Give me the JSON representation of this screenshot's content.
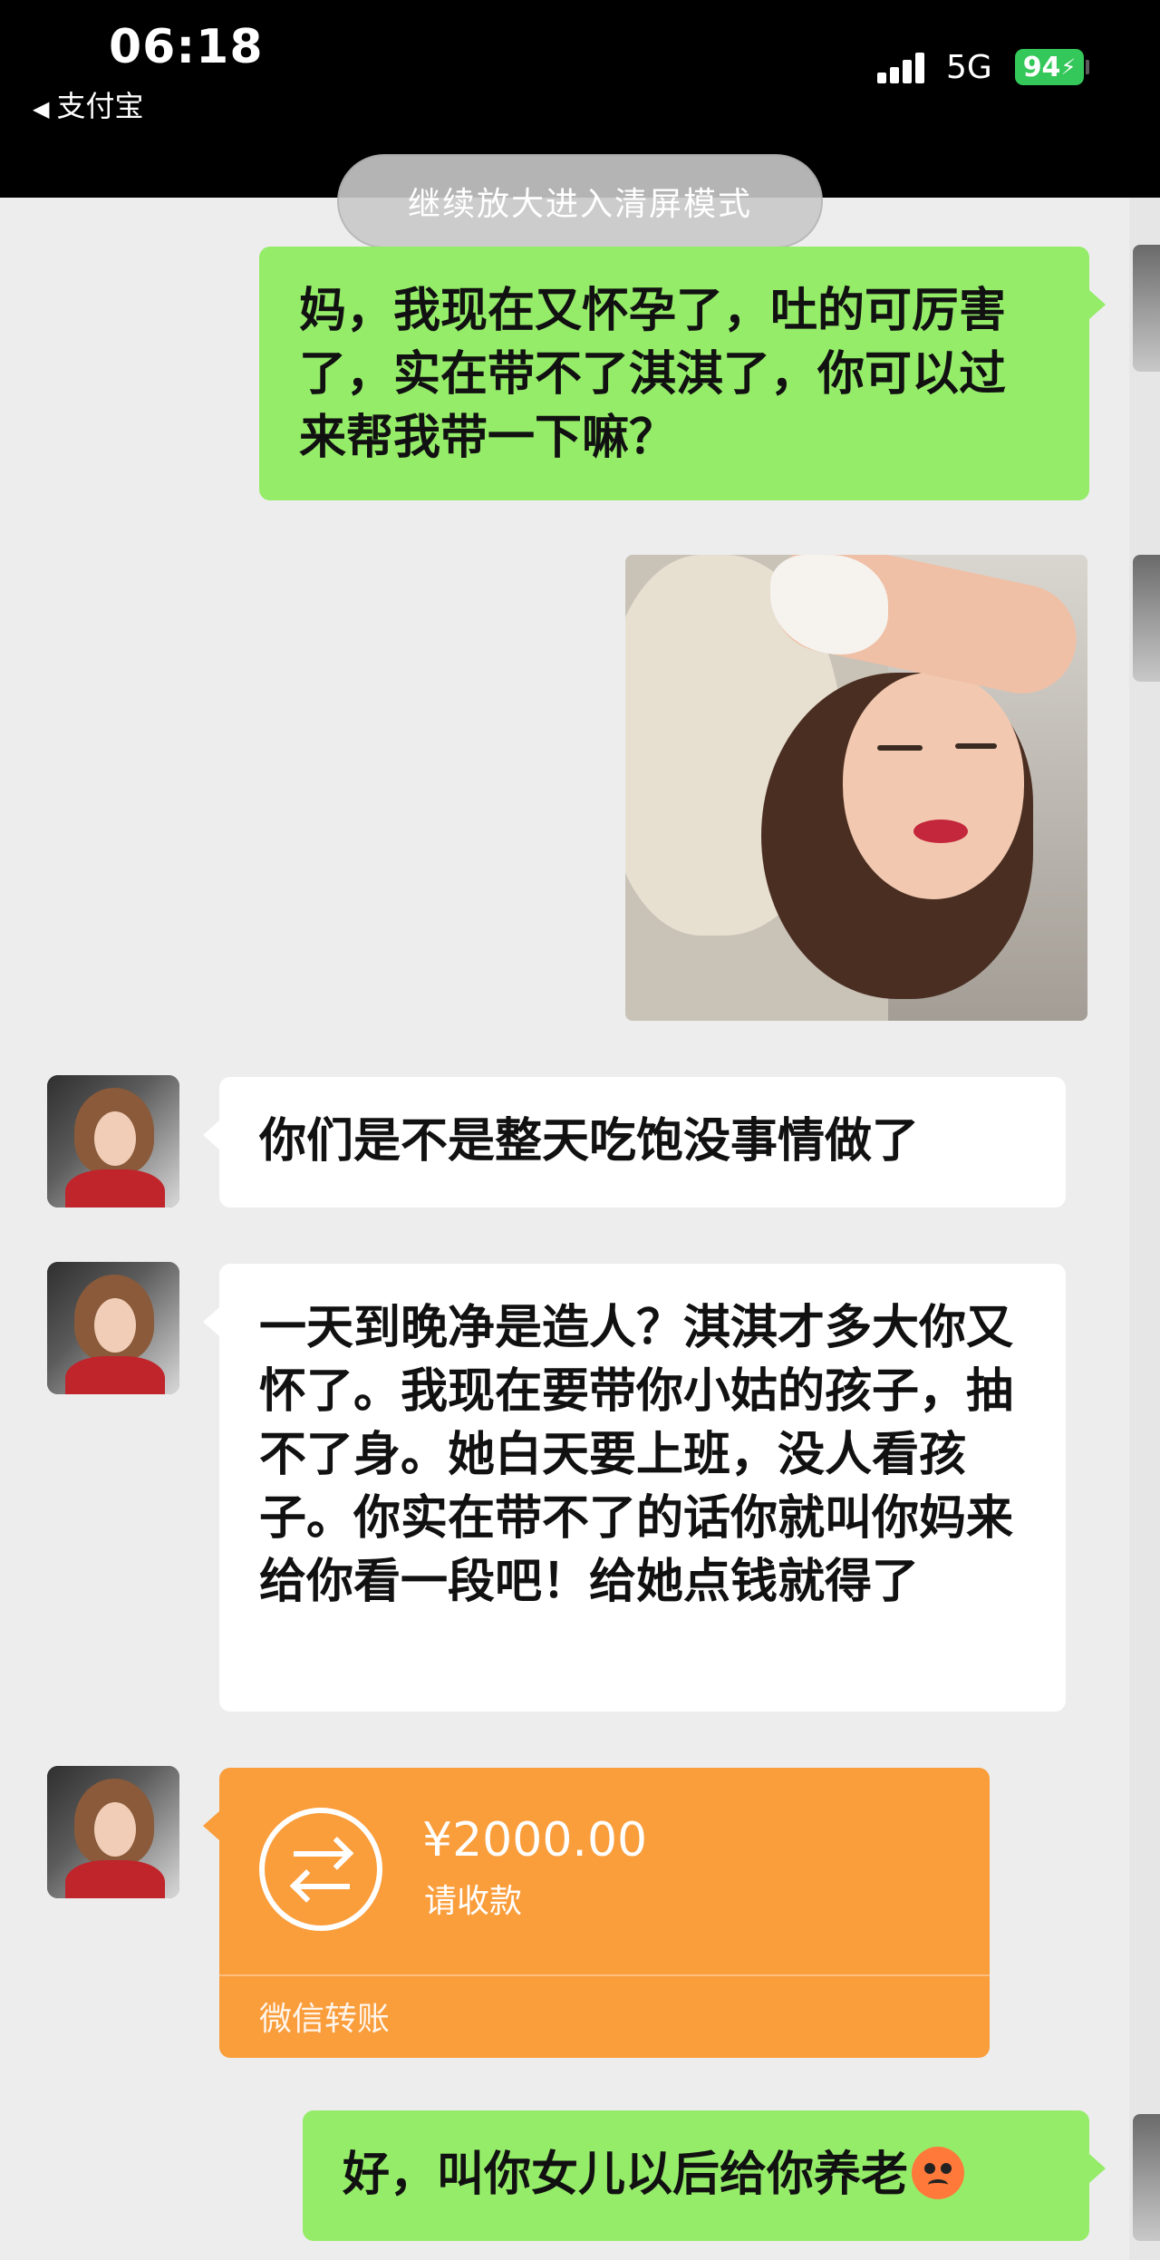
{
  "status_bar": {
    "time": "06:18",
    "back_app": "支付宝",
    "network": "5G",
    "battery": "94"
  },
  "toast": {
    "text": "继续放大进入清屏模式"
  },
  "messages": [
    {
      "from": "me",
      "type": "text",
      "text": "妈，我现在又怀孕了，吐的可厉害了，实在带不了淇淇了，你可以过来帮我带一下嘛？"
    },
    {
      "from": "me",
      "type": "image",
      "image_desc": "woman lying sick in bed"
    },
    {
      "from": "mom",
      "type": "text",
      "text": "你们是不是整天吃饱没事情做了"
    },
    {
      "from": "mom",
      "type": "text",
      "text": "一天到晚净是造人？淇淇才多大你又怀了。我现在要带你小姑的孩子，抽不了身。她白天要上班，没人看孩子。你实在带不了的话你就叫你妈来给你看一段吧！给她点钱就得了"
    },
    {
      "from": "mom",
      "type": "transfer",
      "amount": "¥2000.00",
      "status": "请收款",
      "brand": "微信转账"
    },
    {
      "from": "me",
      "type": "text",
      "text": "好，叫你女儿以后给你养老",
      "emoji": "angry-face"
    }
  ],
  "colors": {
    "sent_bubble": "#95ec69",
    "received_bubble": "#ffffff",
    "transfer": "#fa9d3b",
    "background": "#ededed",
    "battery": "#34c759"
  }
}
